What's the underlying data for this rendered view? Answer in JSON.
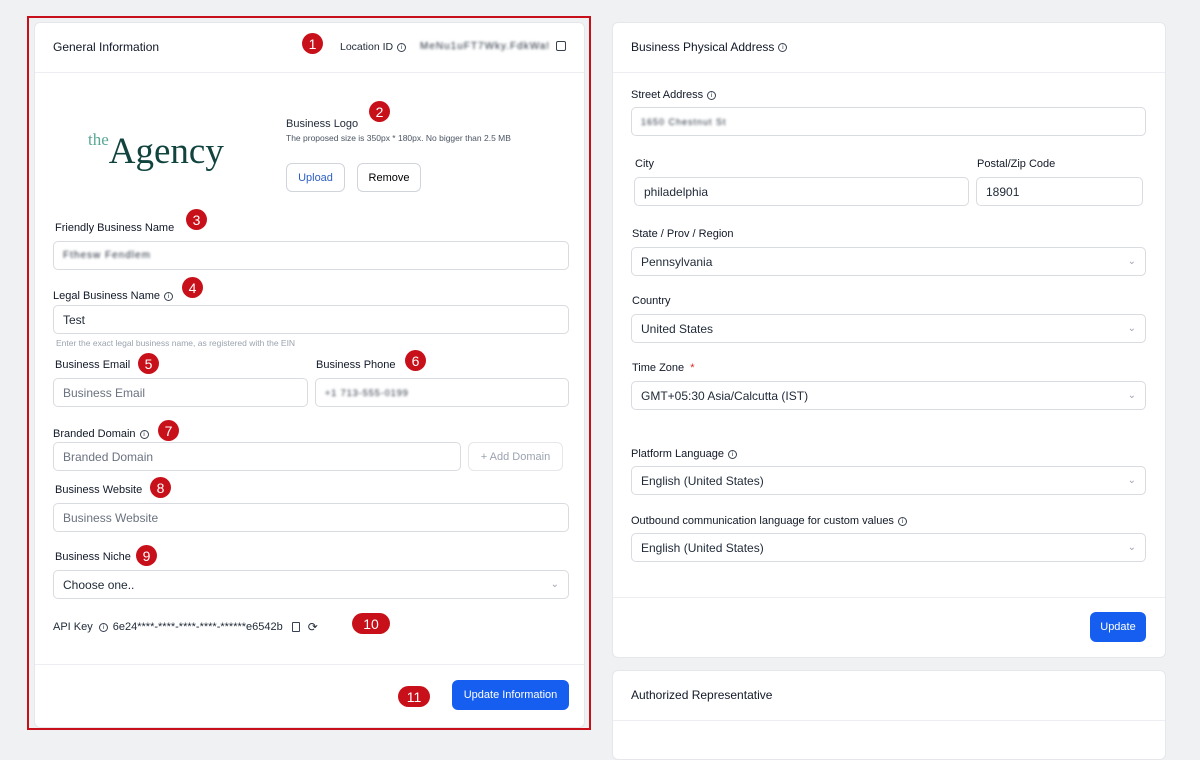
{
  "general": {
    "title": "General Information",
    "location_id_label": "Location ID",
    "location_id_value": "MeNu1uFT7Wky.FdkWaf5",
    "logo_text_small": "the",
    "logo_text_big": "Agency",
    "logo_label": "Business Logo",
    "logo_hint": "The proposed size is 350px * 180px. No bigger than 2.5 MB",
    "upload": "Upload",
    "remove": "Remove",
    "friendly_label": "Friendly Business Name",
    "friendly_value": "Fthesw Fendlem",
    "legal_label": "Legal Business Name",
    "legal_value": "Test",
    "legal_hint": "Enter the exact legal business name, as registered with the EIN",
    "email_label": "Business Email",
    "email_placeholder": "Business Email",
    "phone_label": "Business Phone",
    "phone_value": "+1 713-555-0199",
    "domain_label": "Branded Domain",
    "domain_placeholder": "Branded Domain",
    "add_domain": "+ Add Domain",
    "website_label": "Business Website",
    "website_placeholder": "Business Website",
    "niche_label": "Business Niche",
    "niche_value": "Choose one..",
    "api_label": "API Key",
    "api_value": "6e24****-****-****-****-******e6542b",
    "update": "Update Information"
  },
  "address": {
    "title": "Business Physical Address",
    "street_label": "Street Address",
    "street_value": "1650 Chestnut St",
    "city_label": "City",
    "city_value": "philadelphia",
    "zip_label": "Postal/Zip Code",
    "zip_value": "18901",
    "state_label": "State / Prov / Region",
    "state_value": "Pennsylvania",
    "country_label": "Country",
    "country_value": "United States",
    "tz_label": "Time Zone",
    "tz_required": "*",
    "tz_value": "GMT+05:30 Asia/Calcutta (IST)",
    "platform_lang_label": "Platform Language",
    "platform_lang_value": "English (United States)",
    "outbound_lang_label": "Outbound communication language for custom values",
    "outbound_lang_value": "English (United States)",
    "update": "Update"
  },
  "rep": {
    "title": "Authorized Representative"
  },
  "badges": [
    "1",
    "2",
    "3",
    "4",
    "5",
    "6",
    "7",
    "8",
    "9",
    "10",
    "11"
  ],
  "colors": {
    "annotation_red": "#c8101a",
    "primary": "#155eef"
  }
}
